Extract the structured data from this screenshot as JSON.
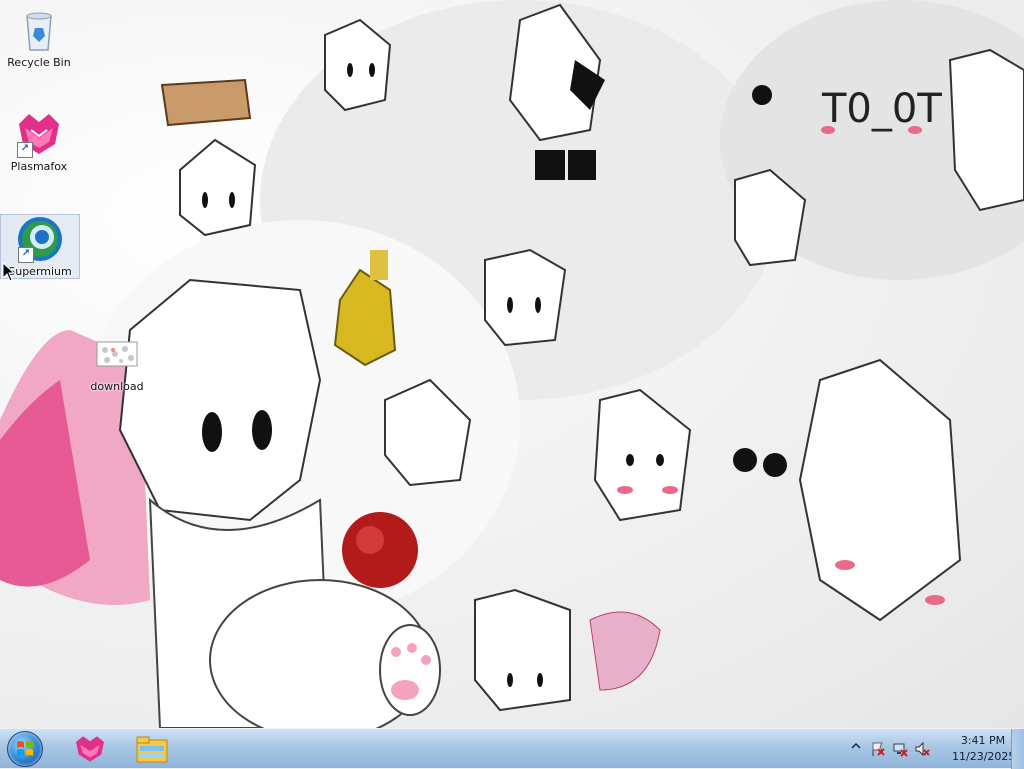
{
  "desktop": {
    "icons": [
      {
        "label": "Recycle Bin",
        "icon": "recycle-bin-icon"
      },
      {
        "label": "Plasmafox",
        "icon": "plasmafox-icon"
      },
      {
        "label": "Supermium",
        "icon": "supermium-icon"
      },
      {
        "label": "download",
        "icon": "image-file-icon"
      }
    ],
    "wallpaper_text": "T0_0T"
  },
  "taskbar": {
    "start": "start-orb-icon",
    "pinned": [
      "plasmafox-icon",
      "file-explorer-icon"
    ],
    "tray": {
      "icons": [
        "show-hidden-icons-arrow",
        "action-center-flag-icon",
        "network-icon",
        "volume-muted-icon"
      ]
    },
    "clock": {
      "time": "3:41 PM",
      "date": "11/23/2025"
    }
  },
  "colors": {
    "taskbar_top": "#cfe2f3",
    "taskbar_bottom": "#8fb4d8",
    "plasmafox_pink": "#e0308a",
    "supermium_blue": "#1c74c9"
  }
}
